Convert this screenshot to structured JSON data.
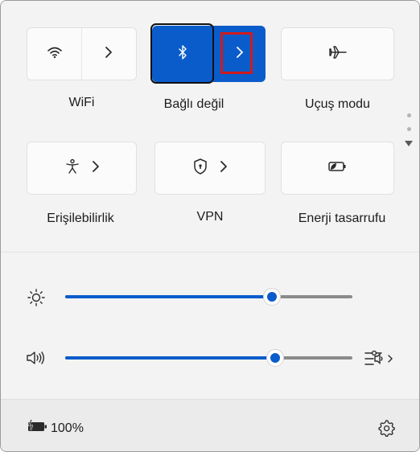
{
  "tiles": {
    "wifi": {
      "label": "WiFi",
      "icon": "wifi-icon",
      "chevron": "chevron-right-icon"
    },
    "bluetooth": {
      "label": "Bağlı değil",
      "icon": "bluetooth-icon",
      "chevron": "chevron-right-icon",
      "state": "on"
    },
    "airplane": {
      "label": "Uçuş modu",
      "icon": "airplane-icon"
    },
    "accessibility": {
      "label": "Erişilebilirlik",
      "icon": "accessibility-icon",
      "chevron": "chevron-right-icon"
    },
    "vpn": {
      "label": "VPN",
      "icon": "shield-icon",
      "chevron": "chevron-right-icon"
    },
    "energy_saver": {
      "label": "Enerji tasarrufu",
      "icon": "energy-saver-icon"
    }
  },
  "sliders": {
    "brightness": {
      "icon": "brightness-icon",
      "value_percent": 72
    },
    "volume": {
      "icon": "speaker-icon",
      "value_percent": 73,
      "extra_icon": "audio-output-icon"
    }
  },
  "footer": {
    "battery_text": "100%",
    "battery_icon": "battery-charging-icon",
    "settings_icon": "gear-icon"
  },
  "colors": {
    "accent": "#0b5ccb",
    "highlight_box": "#d11a1a"
  }
}
